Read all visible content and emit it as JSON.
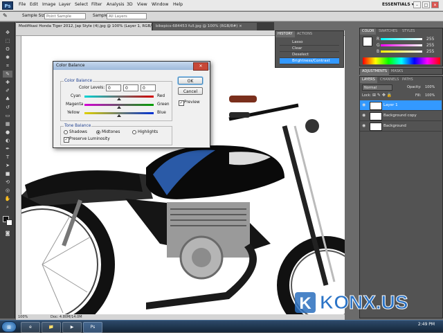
{
  "app": {
    "logo": "Ps",
    "menus": [
      "File",
      "Edit",
      "Image",
      "Layer",
      "Select",
      "Filter",
      "Analysis",
      "3D",
      "View",
      "Window",
      "Help"
    ],
    "workspace": "ESSENTIALS ▾",
    "window_controls": [
      "–",
      "□",
      "✕"
    ]
  },
  "options_bar": {
    "sample_size_label": "Sample Size:",
    "sample_size_value": "Point Sample",
    "sample_label": "Sample:",
    "sample_value": "All Layers"
  },
  "tabs": [
    {
      "label": "Modifikasi Honda Tiger 2012, Jap Style (4).jpg @ 100% (Layer 1, RGB/8*) ×",
      "active": true
    },
    {
      "label": "bikepics-684453 full.jpg @ 100% (RGB/8#) ×",
      "active": false
    }
  ],
  "status": {
    "zoom": "100%",
    "doc": "Doc: 4.80M/14.0M"
  },
  "history": {
    "tabs": [
      "HISTORY",
      "ACTIONS"
    ],
    "items": [
      "Lasso",
      "Clear",
      "Deselect",
      "Brightness/Contrast"
    ]
  },
  "color_panel": {
    "tabs": [
      "COLOR",
      "SWATCHES",
      "STYLES"
    ],
    "channels": [
      {
        "label": "R",
        "value": "255"
      },
      {
        "label": "G",
        "value": "255"
      },
      {
        "label": "B",
        "value": "255"
      }
    ]
  },
  "adjustments": {
    "tabs": [
      "ADJUSTMENTS",
      "MASKS"
    ]
  },
  "layers_panel": {
    "tabs": [
      "LAYERS",
      "CHANNELS",
      "PATHS"
    ],
    "blend_mode": "Normal",
    "opacity_label": "Opacity:",
    "opacity": "100%",
    "lock_label": "Lock:",
    "fill_label": "Fill:",
    "fill": "100%",
    "layers": [
      {
        "name": "Layer 1",
        "selected": true
      },
      {
        "name": "Background copy",
        "selected": false
      },
      {
        "name": "Background",
        "selected": false
      }
    ]
  },
  "dialog": {
    "title": "Color Balance",
    "close": "✕",
    "group_color_balance": "Color Balance",
    "color_levels_label": "Color Levels:",
    "levels": [
      "0",
      "0",
      "0"
    ],
    "sliders": [
      {
        "left": "Cyan",
        "right": "Red",
        "position": 0.5
      },
      {
        "left": "Magenta",
        "right": "Green",
        "position": 0.5
      },
      {
        "left": "Yellow",
        "right": "Blue",
        "position": 0.5
      }
    ],
    "group_tone_balance": "Tone Balance",
    "tones": [
      "Shadows",
      "Midtones",
      "Highlights"
    ],
    "selected_tone": "Midtones",
    "preserve_luminosity": "Preserve Luminosity",
    "ok": "OK",
    "cancel": "Cancel",
    "preview": "Preview",
    "checkmark": "✓"
  },
  "watermark": {
    "text": "KONX.US",
    "logo_text": "K"
  },
  "taskbar": {
    "start": "⊞",
    "clock": "2:49 PM",
    "tasks": [
      "e",
      "📁",
      "▶",
      "Ps"
    ]
  },
  "colors": {
    "accent": "#1e88e5",
    "selected_layer": "#3399ff",
    "panel": "#535353",
    "dialog_bg": "#f0f0f0"
  }
}
